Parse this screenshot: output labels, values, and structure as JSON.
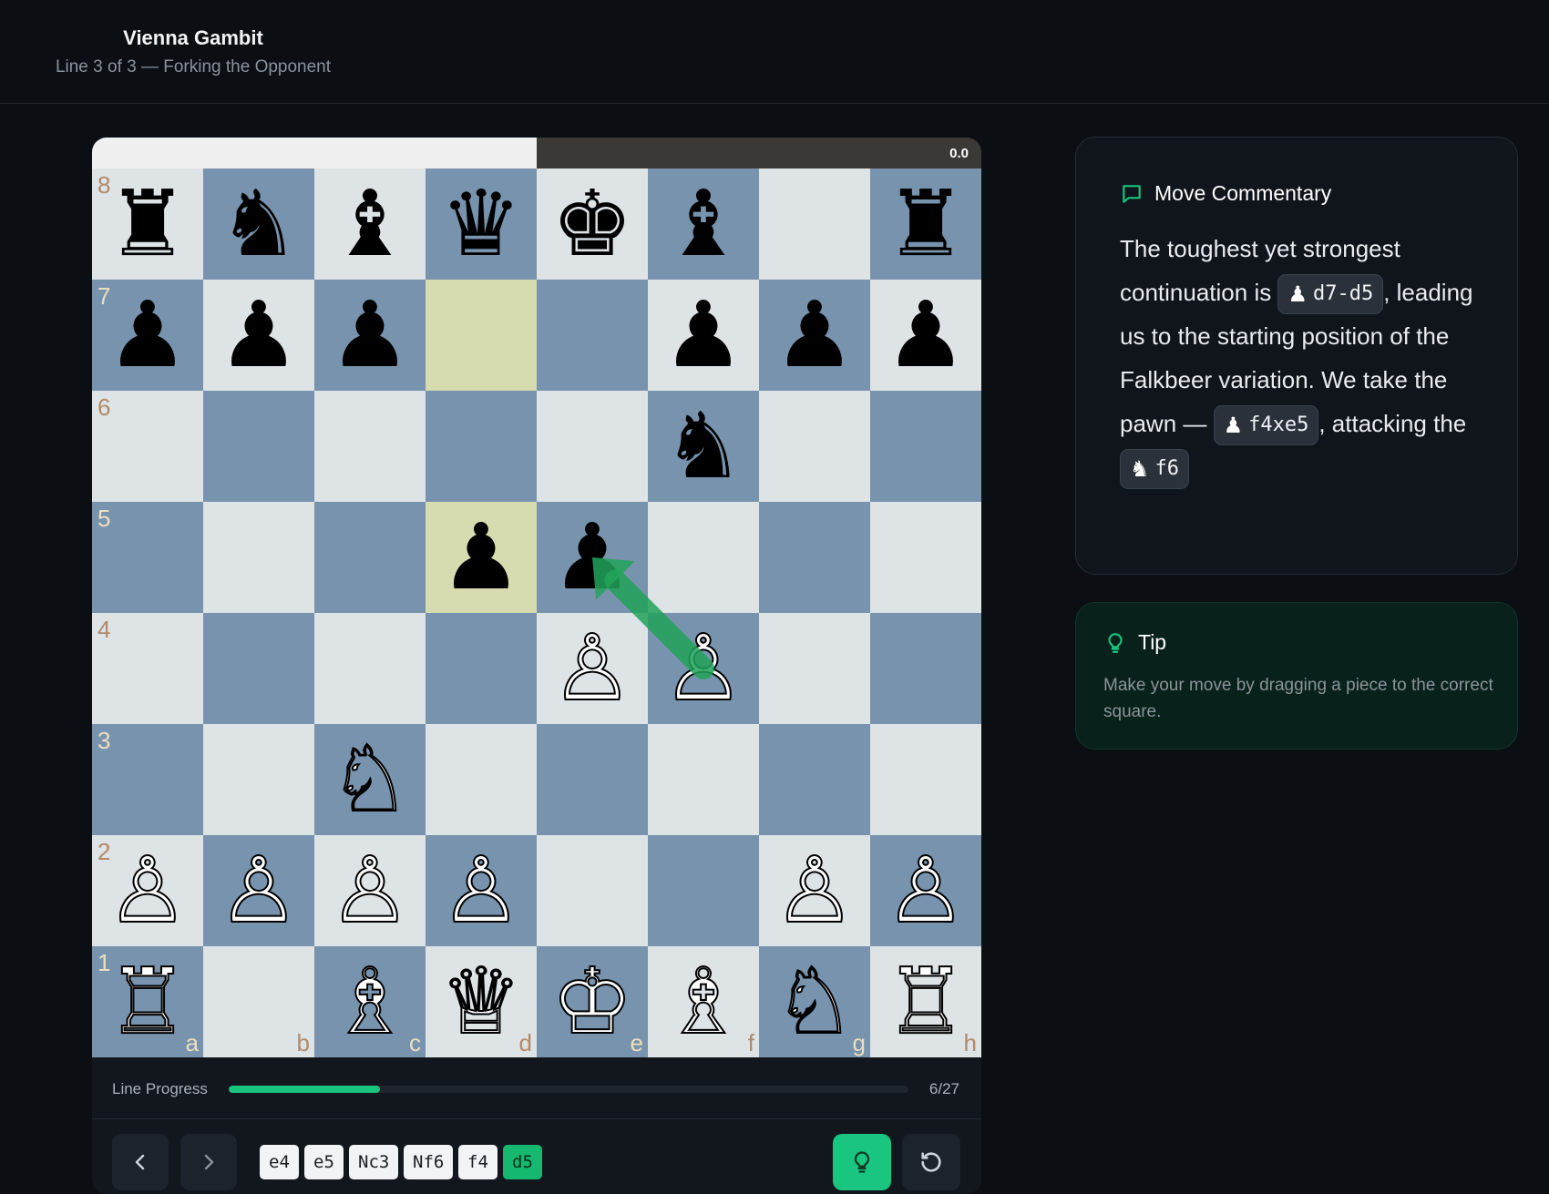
{
  "header": {
    "title": "Vienna Gambit",
    "subtitle": "Line 3 of 3 — Forking the Opponent"
  },
  "eval": {
    "score": "0.0",
    "white_fraction": 0.5
  },
  "board": {
    "files": [
      "a",
      "b",
      "c",
      "d",
      "e",
      "f",
      "g",
      "h"
    ],
    "ranks": [
      "8",
      "7",
      "6",
      "5",
      "4",
      "3",
      "2",
      "1"
    ],
    "highlight": [
      "d7",
      "d5"
    ],
    "arrow": {
      "from": "f4",
      "to": "e5",
      "color": "#22a35a"
    },
    "pieces": [
      {
        "sq": "a8",
        "c": "b",
        "t": "r"
      },
      {
        "sq": "b8",
        "c": "b",
        "t": "n"
      },
      {
        "sq": "c8",
        "c": "b",
        "t": "b"
      },
      {
        "sq": "d8",
        "c": "b",
        "t": "q"
      },
      {
        "sq": "e8",
        "c": "b",
        "t": "k"
      },
      {
        "sq": "f8",
        "c": "b",
        "t": "b"
      },
      {
        "sq": "h8",
        "c": "b",
        "t": "r"
      },
      {
        "sq": "a7",
        "c": "b",
        "t": "p"
      },
      {
        "sq": "b7",
        "c": "b",
        "t": "p"
      },
      {
        "sq": "c7",
        "c": "b",
        "t": "p"
      },
      {
        "sq": "f7",
        "c": "b",
        "t": "p"
      },
      {
        "sq": "g7",
        "c": "b",
        "t": "p"
      },
      {
        "sq": "h7",
        "c": "b",
        "t": "p"
      },
      {
        "sq": "f6",
        "c": "b",
        "t": "n"
      },
      {
        "sq": "d5",
        "c": "b",
        "t": "p"
      },
      {
        "sq": "e5",
        "c": "b",
        "t": "p"
      },
      {
        "sq": "e4",
        "c": "w",
        "t": "p"
      },
      {
        "sq": "f4",
        "c": "w",
        "t": "p"
      },
      {
        "sq": "c3",
        "c": "w",
        "t": "n"
      },
      {
        "sq": "a2",
        "c": "w",
        "t": "p"
      },
      {
        "sq": "b2",
        "c": "w",
        "t": "p"
      },
      {
        "sq": "c2",
        "c": "w",
        "t": "p"
      },
      {
        "sq": "d2",
        "c": "w",
        "t": "p"
      },
      {
        "sq": "g2",
        "c": "w",
        "t": "p"
      },
      {
        "sq": "h2",
        "c": "w",
        "t": "p"
      },
      {
        "sq": "a1",
        "c": "w",
        "t": "r"
      },
      {
        "sq": "c1",
        "c": "w",
        "t": "b"
      },
      {
        "sq": "d1",
        "c": "w",
        "t": "q"
      },
      {
        "sq": "e1",
        "c": "w",
        "t": "k"
      },
      {
        "sq": "f1",
        "c": "w",
        "t": "b"
      },
      {
        "sq": "g1",
        "c": "w",
        "t": "n"
      },
      {
        "sq": "h1",
        "c": "w",
        "t": "r"
      }
    ]
  },
  "progress": {
    "label": "Line Progress",
    "count": "6/27",
    "fraction": 0.222
  },
  "moves": [
    {
      "san": "e4",
      "active": false
    },
    {
      "san": "e5",
      "active": false
    },
    {
      "san": "Nc3",
      "active": false
    },
    {
      "san": "Nf6",
      "active": false
    },
    {
      "san": "f4",
      "active": false
    },
    {
      "san": "d5",
      "active": true
    }
  ],
  "commentary": {
    "title": "Move Commentary",
    "t1": "The toughest yet strongest continuation is ",
    "m1": "d7-d5",
    "t2": ", leading us to the starting position of the Falkbeer variation. We take the pawn — ",
    "m2": "f4xe5",
    "t3": ", attacking the ",
    "m3": "f6"
  },
  "tip": {
    "title": "Tip",
    "text": "Make your move by dragging a piece to the correct square."
  },
  "colors": {
    "accent": "#19c37d",
    "light_square": "#dee3e6",
    "dark_square": "#7893ad",
    "highlight": "#d6dbb0"
  }
}
